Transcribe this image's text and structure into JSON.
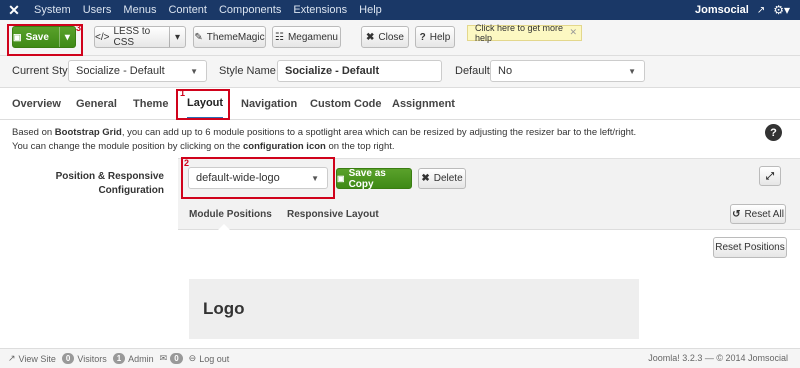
{
  "topbar": {
    "logo": "✕",
    "menu": [
      "System",
      "Users",
      "Menus",
      "Content",
      "Components",
      "Extensions",
      "Help"
    ],
    "site_name": "Jomsocial",
    "external_icon": "↗"
  },
  "toolbar": {
    "save_label": "Save",
    "save_number": "3",
    "less_label": "LESS to CSS",
    "thememagic_label": "ThemeMagic",
    "megamenu_label": "Megamenu",
    "close_label": "Close",
    "help_label": "Help",
    "help_tip": "Click here to get more help"
  },
  "style_row": {
    "current_style_label": "Current Style",
    "current_style_value": "Socialize - Default",
    "style_name_label": "Style Name *",
    "style_name_value": "Socialize - Default",
    "default_label": "Default",
    "default_value": "No"
  },
  "tabs": [
    "Overview",
    "General",
    "Theme",
    "Layout",
    "Navigation",
    "Custom Code",
    "Assignment"
  ],
  "active_tab_number": "1",
  "description": {
    "part1": "Based on ",
    "bold1": "Bootstrap Grid",
    "part2": ", you can add up to 6 module positions to a spotlight area which can be resized by adjusting the resizer bar to the left/right.",
    "part3": "You can change the module position by clicking on the ",
    "bold2": "configuration icon",
    "part4": " on the top right."
  },
  "layout": {
    "position_label": "Position & Responsive Configuration",
    "layout_select_value": "default-wide-logo",
    "layout_number": "2",
    "save_copy_label": "Save as Copy",
    "delete_label": "Delete",
    "subtabs": [
      "Module Positions",
      "Responsive Layout"
    ],
    "reset_all_label": "Reset All",
    "reset_positions_label": "Reset Positions",
    "logo_block": "Logo"
  },
  "footer": {
    "view_site": "View Site",
    "visitors_count": "0",
    "visitors_label": "Visitors",
    "admin_count": "1",
    "admin_label": "Admin",
    "messages_count": "0",
    "logout": "Log out",
    "version": "Joomla! 3.2.3 — © 2014 Jomsocial"
  },
  "colors": {
    "topbar": "#1a3867",
    "save_green": "#4c9a22",
    "highlight_red": "#d0021b",
    "active_tab_underline": "#2b6eb4"
  }
}
